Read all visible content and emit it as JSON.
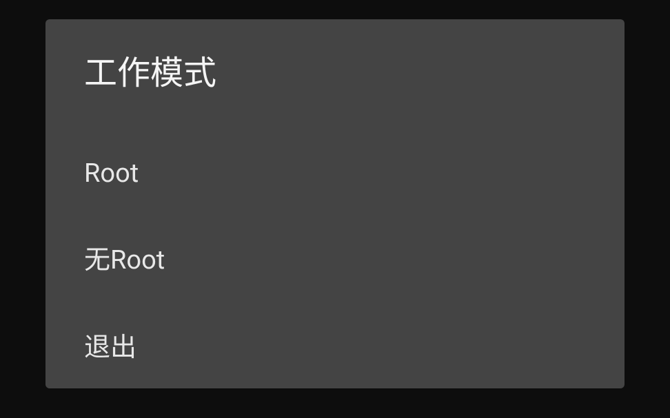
{
  "dialog": {
    "title": "工作模式",
    "options": [
      "Root",
      "无Root",
      "退出"
    ]
  }
}
